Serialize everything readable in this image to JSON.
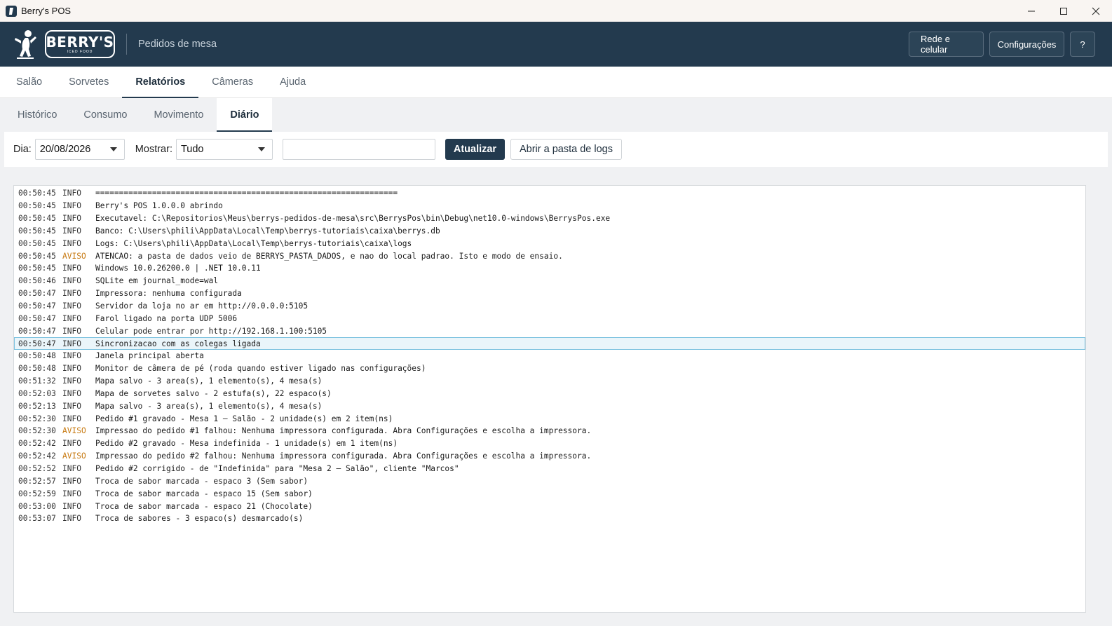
{
  "window": {
    "title": "Berry's POS",
    "icon": "app-icon",
    "controls": [
      "minimize",
      "maximize",
      "close"
    ]
  },
  "header": {
    "brand": "BERRY'S",
    "brand_sub": "ICED FOOD",
    "subtitle": "Pedidos de mesa",
    "buttons": {
      "network": "Rede e celular",
      "settings": "Configurações",
      "help": "?"
    },
    "bg_color": "#233a4e"
  },
  "main_tabs": [
    {
      "label": "Salão",
      "active": false
    },
    {
      "label": "Sorvetes",
      "active": false
    },
    {
      "label": "Relatórios",
      "active": true
    },
    {
      "label": "Câmeras",
      "active": false
    },
    {
      "label": "Ajuda",
      "active": false
    }
  ],
  "sub_tabs": [
    {
      "label": "Histórico",
      "active": false
    },
    {
      "label": "Consumo",
      "active": false
    },
    {
      "label": "Movimento",
      "active": false
    },
    {
      "label": "Diário",
      "active": true
    }
  ],
  "toolbar": {
    "day_label": "Dia:",
    "day_value": "20/08/2026",
    "show_label": "Mostrar:",
    "show_value": "Tudo",
    "filter_value": "",
    "refresh_button": "Atualizar",
    "open_logs_button": "Abrir a pasta de logs"
  },
  "log": {
    "warn_color": "#c77a12",
    "selected_index": 12,
    "entries": [
      {
        "time": "00:50:45",
        "level": "INFO",
        "msg": "================================================================"
      },
      {
        "time": "00:50:45",
        "level": "INFO",
        "msg": "Berry's POS 1.0.0.0 abrindo"
      },
      {
        "time": "00:50:45",
        "level": "INFO",
        "msg": "Executavel: C:\\Repositorios\\Meus\\berrys-pedidos-de-mesa\\src\\BerrysPos\\bin\\Debug\\net10.0-windows\\BerrysPos.exe"
      },
      {
        "time": "00:50:45",
        "level": "INFO",
        "msg": "Banco: C:\\Users\\phili\\AppData\\Local\\Temp\\berrys-tutoriais\\caixa\\berrys.db"
      },
      {
        "time": "00:50:45",
        "level": "INFO",
        "msg": "Logs: C:\\Users\\phili\\AppData\\Local\\Temp\\berrys-tutoriais\\caixa\\logs"
      },
      {
        "time": "00:50:45",
        "level": "AVISO",
        "msg": "ATENCAO: a pasta de dados veio de BERRYS_PASTA_DADOS, e nao do local padrao. Isto e modo de ensaio."
      },
      {
        "time": "00:50:45",
        "level": "INFO",
        "msg": "Windows 10.0.26200.0 | .NET 10.0.11"
      },
      {
        "time": "00:50:46",
        "level": "INFO",
        "msg": "SQLite em journal_mode=wal"
      },
      {
        "time": "00:50:47",
        "level": "INFO",
        "msg": "Impressora: nenhuma configurada"
      },
      {
        "time": "00:50:47",
        "level": "INFO",
        "msg": "Servidor da loja no ar em http://0.0.0.0:5105"
      },
      {
        "time": "00:50:47",
        "level": "INFO",
        "msg": "Farol ligado na porta UDP 5006"
      },
      {
        "time": "00:50:47",
        "level": "INFO",
        "msg": "Celular pode entrar por http://192.168.1.100:5105"
      },
      {
        "time": "00:50:47",
        "level": "INFO",
        "msg": "Sincronizacao com as colegas ligada"
      },
      {
        "time": "00:50:48",
        "level": "INFO",
        "msg": "Janela principal aberta"
      },
      {
        "time": "00:50:48",
        "level": "INFO",
        "msg": "Monitor de câmera de pé (roda quando estiver ligado nas configurações)"
      },
      {
        "time": "00:51:32",
        "level": "INFO",
        "msg": "Mapa salvo - 3 area(s), 1 elemento(s), 4 mesa(s)"
      },
      {
        "time": "00:52:03",
        "level": "INFO",
        "msg": "Mapa de sorvetes salvo - 2 estufa(s), 22 espaco(s)"
      },
      {
        "time": "00:52:13",
        "level": "INFO",
        "msg": "Mapa salvo - 3 area(s), 1 elemento(s), 4 mesa(s)"
      },
      {
        "time": "00:52:30",
        "level": "INFO",
        "msg": "Pedido #1 gravado - Mesa 1 — Salão - 2 unidade(s) em 2 item(ns)"
      },
      {
        "time": "00:52:30",
        "level": "AVISO",
        "msg": "Impressao do pedido #1 falhou: Nenhuma impressora configurada. Abra Configurações e escolha a impressora."
      },
      {
        "time": "00:52:42",
        "level": "INFO",
        "msg": "Pedido #2 gravado - Mesa indefinida - 1 unidade(s) em 1 item(ns)"
      },
      {
        "time": "00:52:42",
        "level": "AVISO",
        "msg": "Impressao do pedido #2 falhou: Nenhuma impressora configurada. Abra Configurações e escolha a impressora."
      },
      {
        "time": "00:52:52",
        "level": "INFO",
        "msg": "Pedido #2 corrigido - de \"Indefinida\" para \"Mesa 2 — Salão\", cliente \"Marcos\""
      },
      {
        "time": "00:52:57",
        "level": "INFO",
        "msg": "Troca de sabor marcada - espaco 3 (Sem sabor)"
      },
      {
        "time": "00:52:59",
        "level": "INFO",
        "msg": "Troca de sabor marcada - espaco 15 (Sem sabor)"
      },
      {
        "time": "00:53:00",
        "level": "INFO",
        "msg": "Troca de sabor marcada - espaco 21 (Chocolate)"
      },
      {
        "time": "00:53:07",
        "level": "INFO",
        "msg": "Troca de sabores - 3 espaco(s) desmarcado(s)"
      }
    ]
  }
}
